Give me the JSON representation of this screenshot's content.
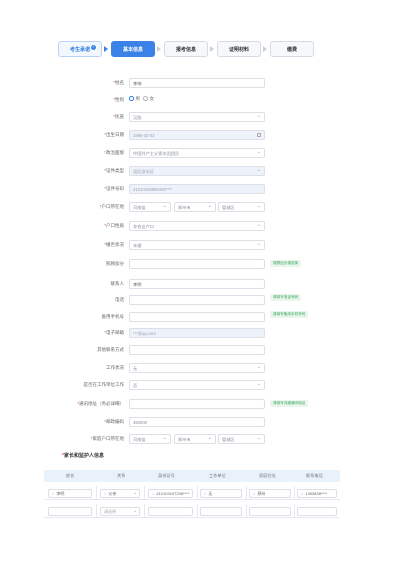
{
  "steps": [
    {
      "label": "考生承诺",
      "state": "done",
      "badge": "✓"
    },
    {
      "label": "基本信息",
      "state": "active"
    },
    {
      "label": "报考信息",
      "state": "todo"
    },
    {
      "label": "证明材料",
      "state": "todo"
    },
    {
      "label": "缴费",
      "state": "todo"
    }
  ],
  "form": {
    "name": {
      "label": "姓名",
      "value": "李响"
    },
    "gender": {
      "label": "性别",
      "options": [
        "男",
        "女"
      ],
      "selected": "男"
    },
    "ethnic": {
      "label": "民族",
      "value": "汉族"
    },
    "birthday": {
      "label": "出生日期",
      "value": "1998-03-03"
    },
    "politics": {
      "label": "政治面貌",
      "value": "中国共产主义青年团团员"
    },
    "id_type": {
      "label": "证件类型",
      "value": "居民身份证"
    },
    "id_number": {
      "label": "证件号码",
      "value": "41010319980303****"
    },
    "residence": {
      "label": "户口所在地",
      "province": "河南省",
      "city": "郑州市",
      "district": "管城区"
    },
    "residence_type": {
      "label": "户口性质",
      "value": "非农业户口"
    },
    "marital": {
      "label": "婚否状况",
      "value": "未婚"
    },
    "extra_points": {
      "label": "照顾加分",
      "value": "",
      "tip": "照顾加分请选择"
    },
    "contact": {
      "label": "联系人",
      "value": "李明"
    },
    "phone": {
      "label": "电话",
      "value": "",
      "tip": "请填写电话号码"
    },
    "backup_phone": {
      "label": "备用手机号",
      "value": "",
      "tip": "请填写备用手机号码"
    },
    "email": {
      "label": "电子邮箱",
      "value": "***@qq.com"
    },
    "other_contact": {
      "label": "其他联系方式",
      "value": ""
    },
    "work_status": {
      "label": "工作状况",
      "value": "无"
    },
    "is_working": {
      "label": "是否在工作单位工作",
      "value": "否"
    },
    "address": {
      "label": "通讯地址（务必详细）",
      "value": "",
      "tip": "请填写详细通讯地址"
    },
    "postcode": {
      "label": "邮政编码",
      "value": "450000"
    },
    "home_address": {
      "label": "家庭户口所在地",
      "province": "河南省",
      "city": "郑州市",
      "district": "管城区"
    }
  },
  "family": {
    "title": "家长和监护人信息",
    "headers": [
      "姓名",
      "关系",
      "身份证号",
      "工作单位",
      "家庭住址",
      "联系电话"
    ],
    "rows": [
      [
        "李明",
        "父亲",
        "410103197208****",
        "无",
        "郑州",
        "1393838****"
      ],
      [
        "",
        "请选择",
        "",
        "",
        "",
        ""
      ]
    ]
  }
}
